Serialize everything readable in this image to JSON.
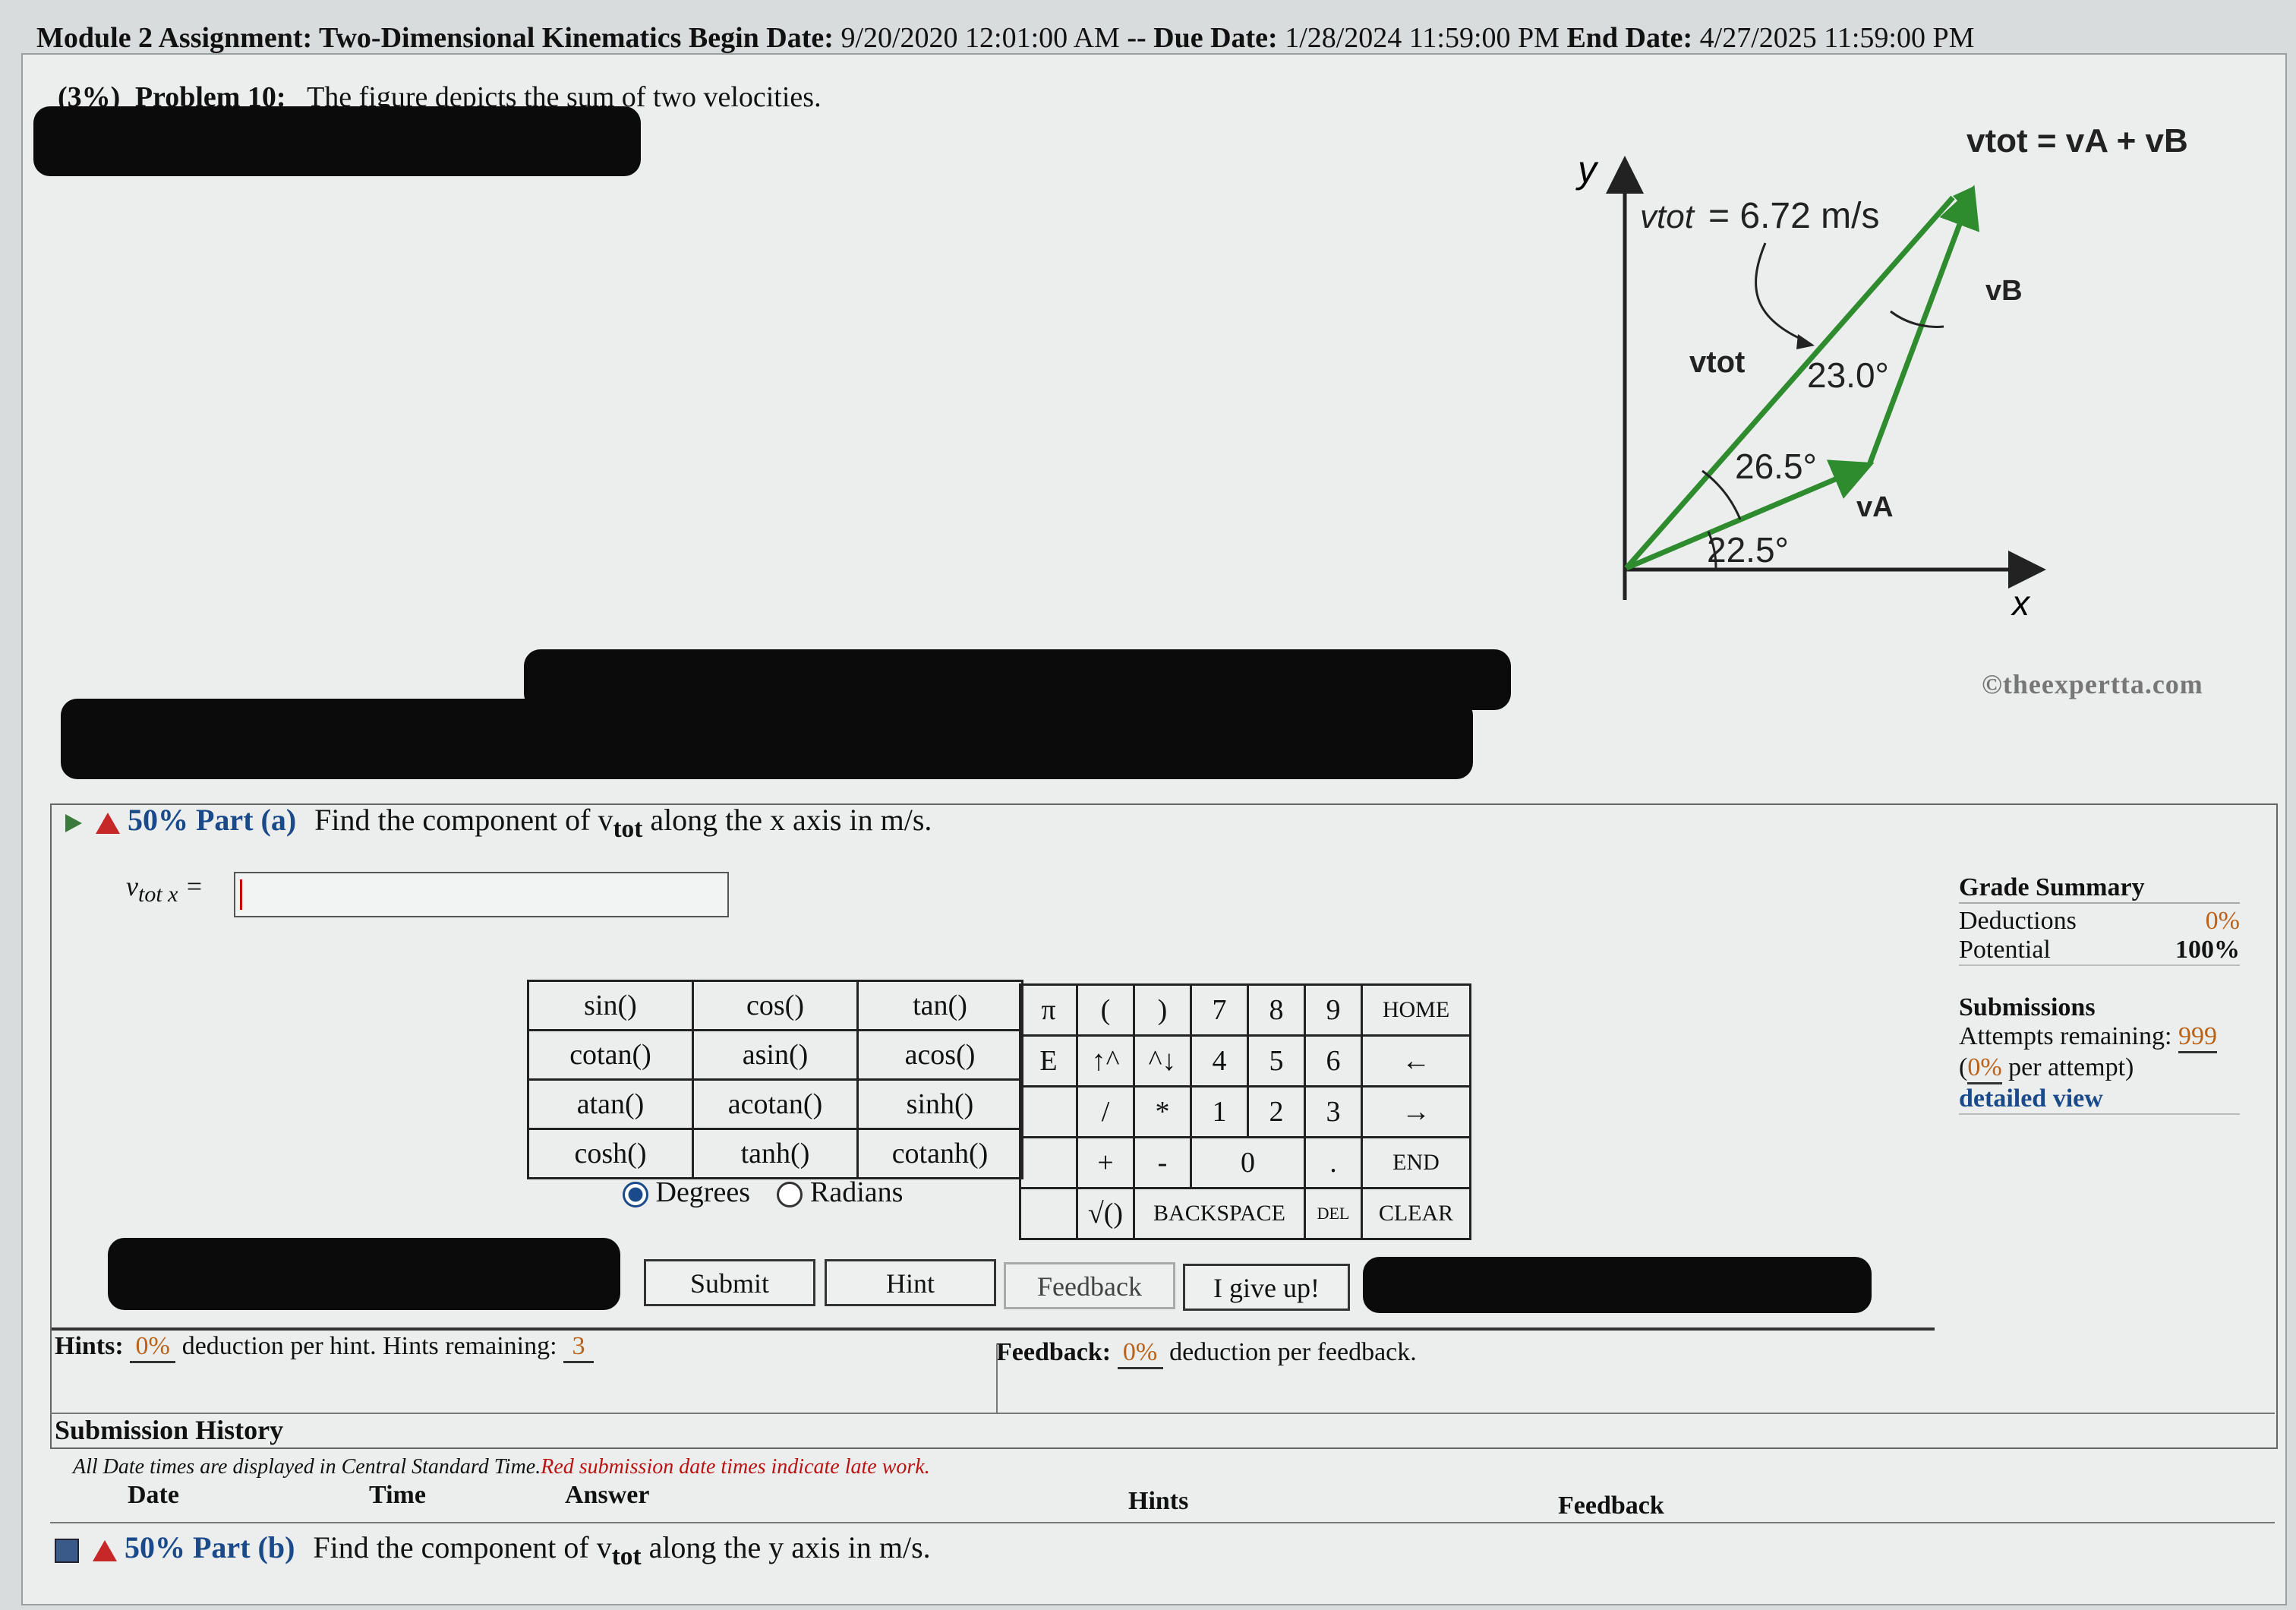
{
  "header": {
    "assignment": "Module 2 Assignment: Two-Dimensional Kinematics",
    "begin_label": "Begin Date:",
    "begin_value": "9/20/2020 12:01:00 AM",
    "sep": "--",
    "due_label": "Due Date:",
    "due_value": "1/28/2024 11:59:00 PM",
    "end_label": "End Date:",
    "end_value": "4/27/2025 11:59:00 PM"
  },
  "problem": {
    "weight": "(3%)",
    "number": "Problem 10:",
    "statement": "The figure depicts the sum of two velocities."
  },
  "figure": {
    "equation": "vtot = vA + vB",
    "y_axis": "y",
    "x_axis": "x",
    "vtot_label": "vtot",
    "vtot_value": "= 6.72 m/s",
    "va_label": "vA",
    "vb_label": "vB",
    "angle_top": "23.0°",
    "angle_mid": "26.5°",
    "angle_bottom": "22.5°",
    "copyright": "©theexpertta.com",
    "colors": {
      "vector": "#2e8b2e",
      "axis": "#222222"
    }
  },
  "part_a": {
    "percent": "50%",
    "part": "Part (a)",
    "prompt_pre": "Find the component of v",
    "prompt_sub": "tot",
    "prompt_post": "along the x axis in m/s.",
    "input_label": "v",
    "input_label_sub": "tot x",
    "input_eq": "=",
    "input_value": ""
  },
  "functions": [
    [
      "sin()",
      "cos()",
      "tan()"
    ],
    [
      "cotan()",
      "asin()",
      "acos()"
    ],
    [
      "atan()",
      "acotan()",
      "sinh()"
    ],
    [
      "cosh()",
      "tanh()",
      "cotanh()"
    ]
  ],
  "keypad": {
    "r1": [
      "π",
      "(",
      ")",
      "7",
      "8",
      "9",
      "HOME"
    ],
    "r2": [
      "E",
      "↑^",
      "^↓",
      "4",
      "5",
      "6",
      "←"
    ],
    "r3": [
      "",
      "/",
      "*",
      "1",
      "2",
      "3",
      "→"
    ],
    "r4": [
      "",
      "+",
      "-",
      "0",
      ".",
      "END"
    ],
    "r5": [
      "",
      "√()",
      "BACKSPACE",
      "DEL",
      "CLEAR"
    ]
  },
  "angle_mode": {
    "degrees": "Degrees",
    "radians": "Radians",
    "selected": "Degrees"
  },
  "buttons": {
    "submit": "Submit",
    "hint": "Hint",
    "feedback": "Feedback",
    "give_up": "I give up!"
  },
  "hints": {
    "label": "Hints:",
    "deduction": "0%",
    "text": "deduction per hint. Hints remaining:",
    "remaining": "3"
  },
  "feedback": {
    "label": "Feedback:",
    "deduction": "0%",
    "text": "deduction per feedback."
  },
  "grade_summary": {
    "title": "Grade Summary",
    "deductions_label": "Deductions",
    "deductions_value": "0%",
    "potential_label": "Potential",
    "potential_value": "100%"
  },
  "submissions": {
    "title": "Submissions",
    "attempts_label": "Attempts remaining:",
    "attempts_value": "999",
    "per_attempt_pre": "(",
    "per_attempt_value": "0%",
    "per_attempt_post": "per attempt)",
    "detailed_view": "detailed view"
  },
  "history": {
    "title": "Submission History",
    "note_black": "All Date times are displayed in Central Standard Time.",
    "note_red": "Red submission date times indicate late work.",
    "columns": [
      "Date",
      "Time",
      "Answer",
      "Hints",
      "Feedback"
    ]
  },
  "part_b": {
    "percent": "50%",
    "part": "Part (b)",
    "prompt_pre": "Find the component of v",
    "prompt_sub": "tot",
    "prompt_post": "along the y axis in m/s."
  }
}
